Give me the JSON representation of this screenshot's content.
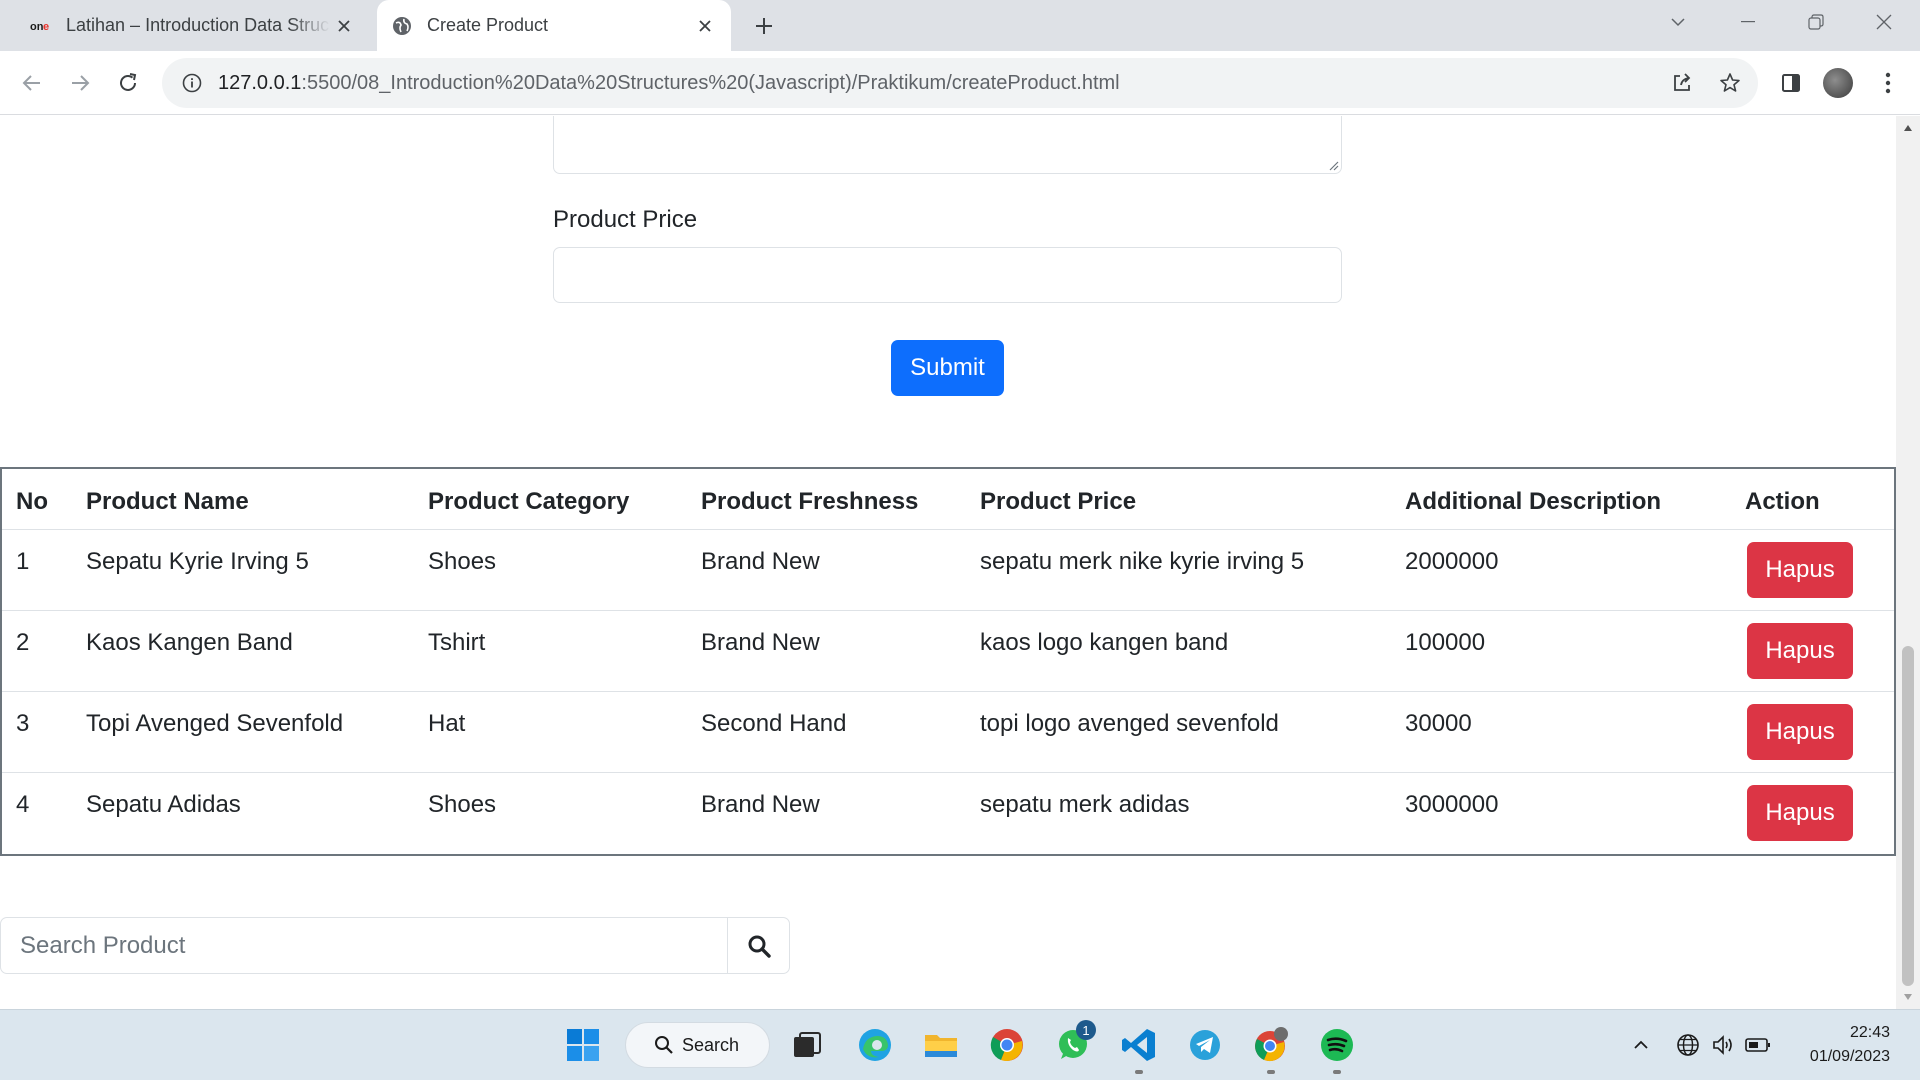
{
  "browser": {
    "tabs": [
      {
        "label": "Latihan – Introduction Data Structures",
        "favicon": "onemedia-logo-icon",
        "active": false
      },
      {
        "label": "Create Product",
        "favicon": "globe-icon",
        "active": true
      }
    ],
    "url_host": "127.0.0.1",
    "url_rest": ":5500/08_Introduction%20Data%20Structures%20(Javascript)/Praktikum/createProduct.html"
  },
  "form": {
    "price_label": "Product Price",
    "price_value": "",
    "submit_label": "Submit"
  },
  "table": {
    "headers": [
      "No",
      "Product Name",
      "Product Category",
      "Product Freshness",
      "Product Price",
      "Additional Description",
      "Action"
    ],
    "rows": [
      {
        "no": "1",
        "name": "Sepatu Kyrie Irving 5",
        "category": "Shoes",
        "freshness": "Brand New",
        "price": "sepatu merk nike kyrie irving 5",
        "description": "2000000",
        "action": "Hapus"
      },
      {
        "no": "2",
        "name": "Kaos Kangen Band",
        "category": "Tshirt",
        "freshness": "Brand New",
        "price": "kaos logo kangen band",
        "description": "100000",
        "action": "Hapus"
      },
      {
        "no": "3",
        "name": "Topi Avenged Sevenfold",
        "category": "Hat",
        "freshness": "Second Hand",
        "price": "topi logo avenged sevenfold",
        "description": "30000",
        "action": "Hapus"
      },
      {
        "no": "4",
        "name": "Sepatu Adidas",
        "category": "Shoes",
        "freshness": "Brand New",
        "price": "sepatu merk adidas",
        "description": "3000000",
        "action": "Hapus"
      }
    ]
  },
  "search": {
    "placeholder": "Search Product"
  },
  "taskbar": {
    "search_label": "Search",
    "whatsapp_badge": "1",
    "time": "22:43",
    "date": "01/09/2023"
  },
  "colors": {
    "primary": "#0d6efd",
    "danger": "#dc3545",
    "text": "#212529",
    "border": "#dee2e6",
    "table_border": "#6c757d"
  }
}
